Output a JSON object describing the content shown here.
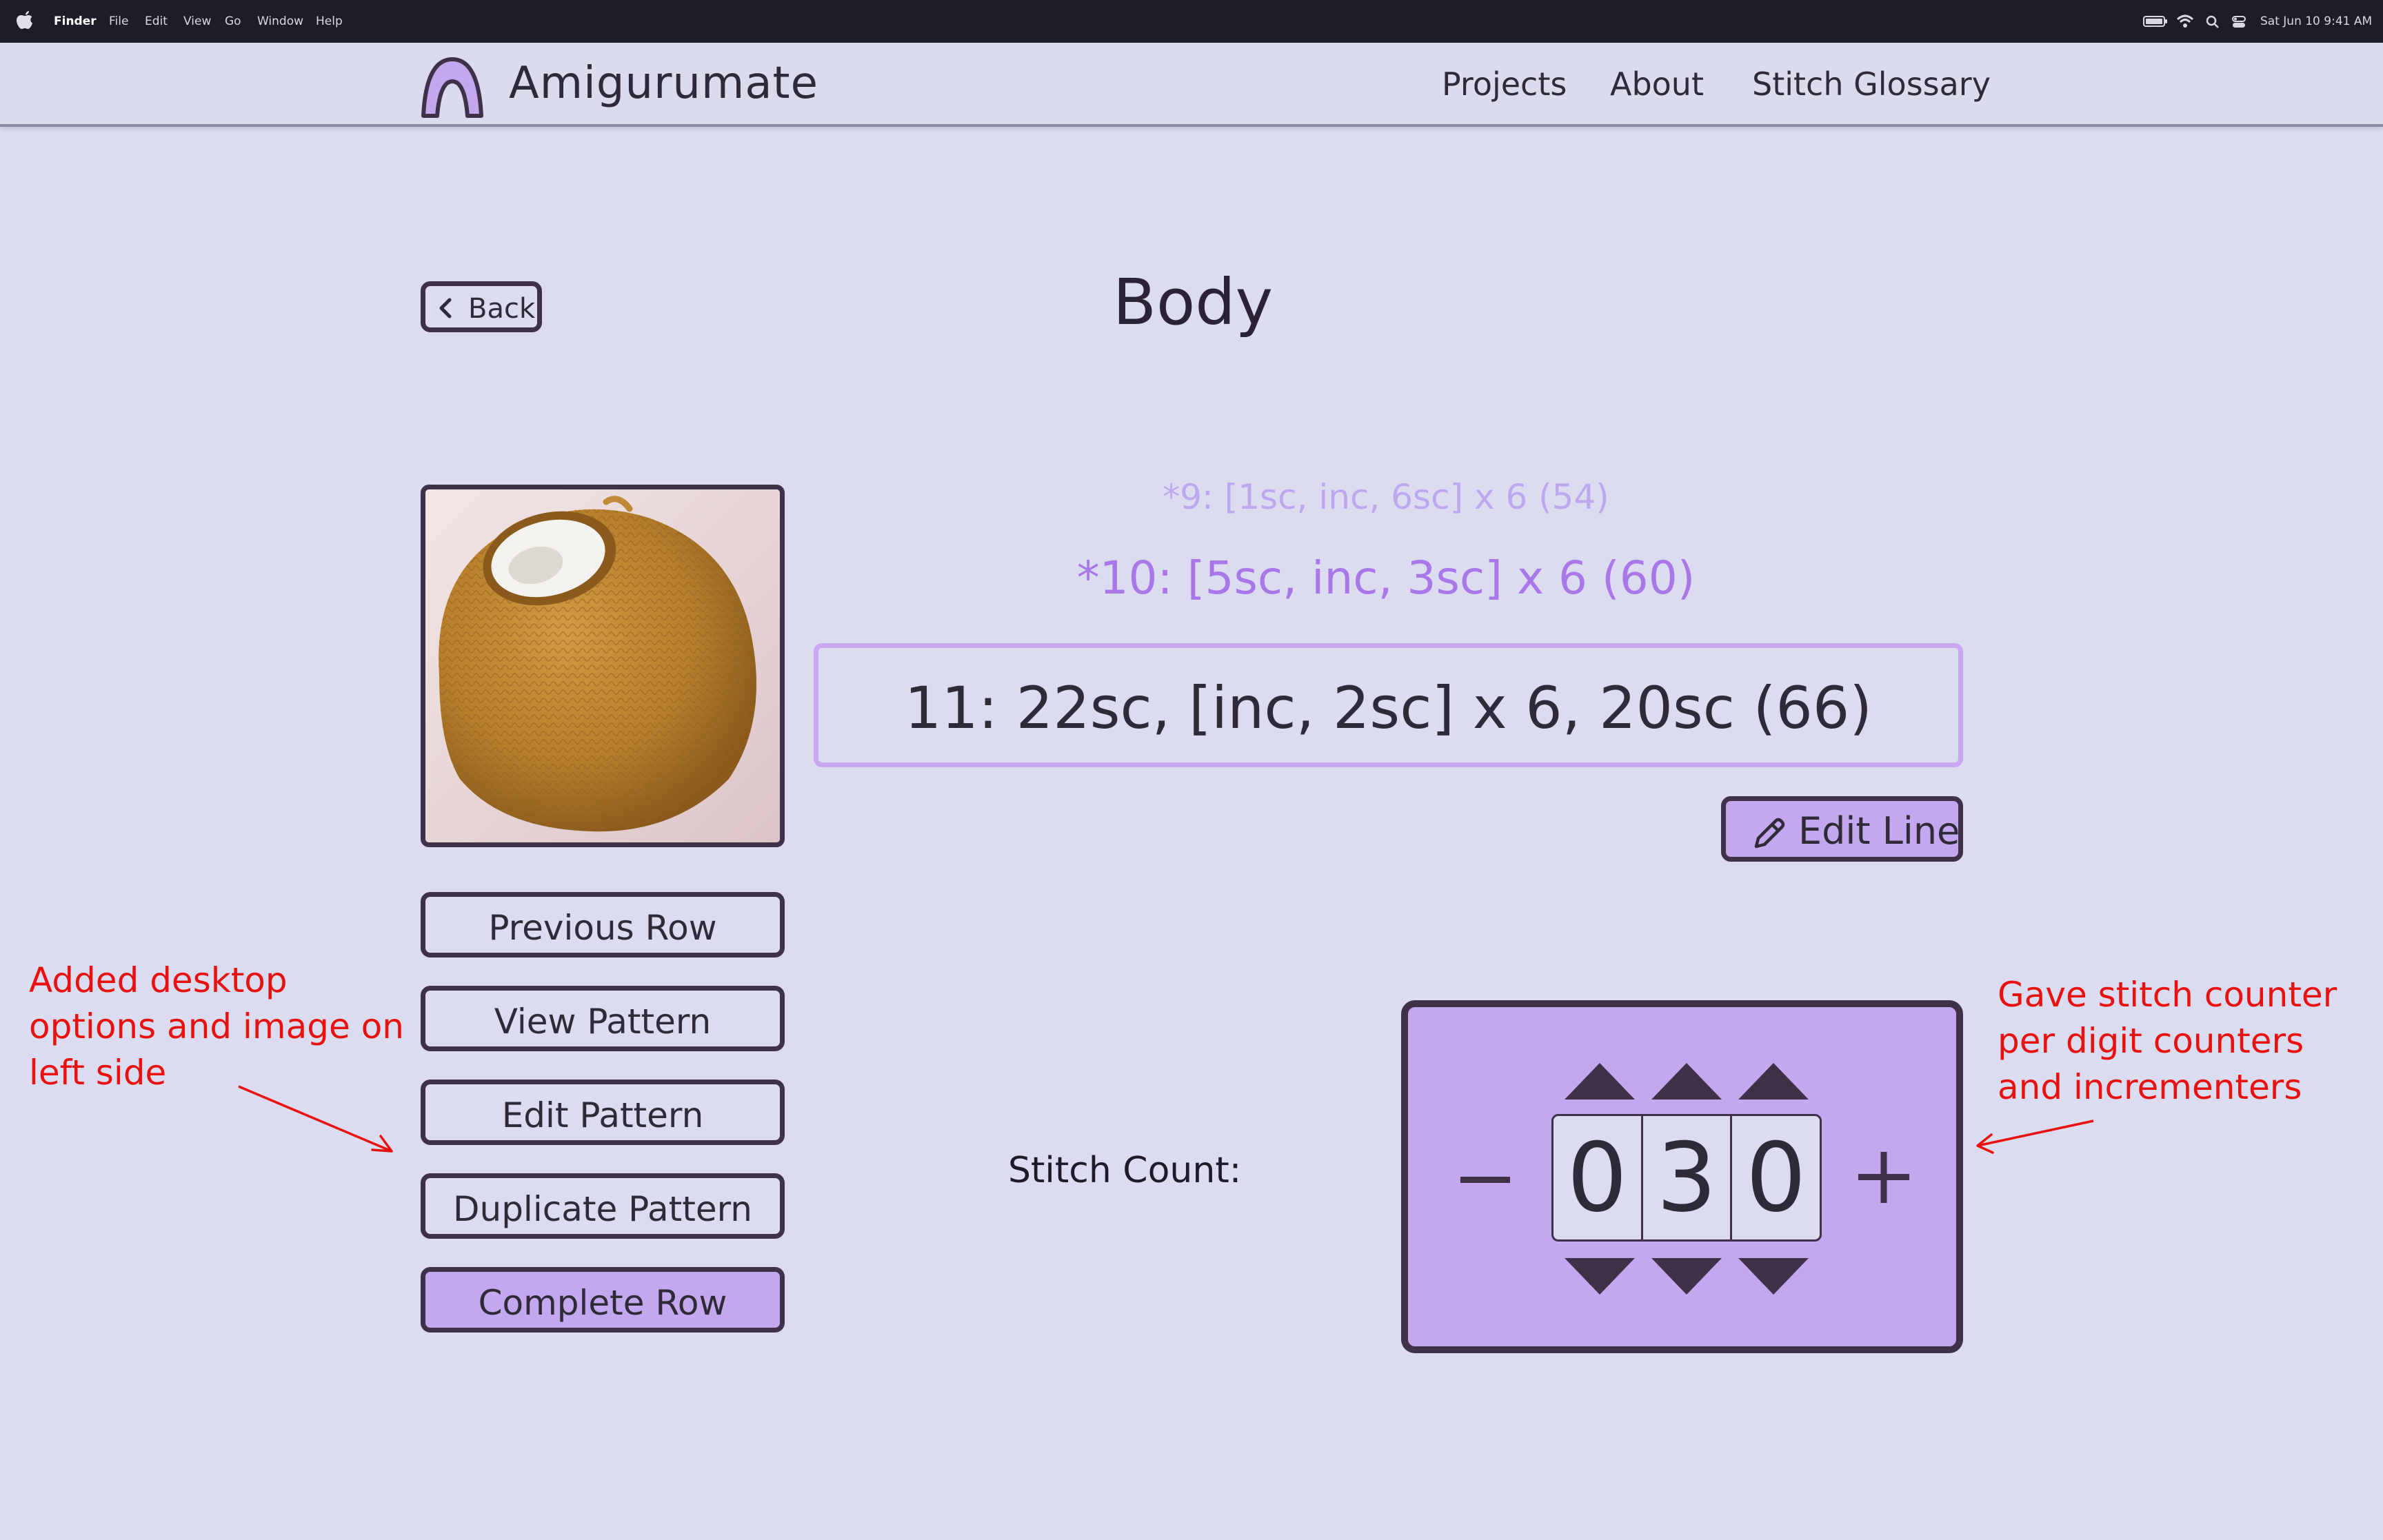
{
  "menubar": {
    "app_name": "Finder",
    "items": [
      "File",
      "Edit",
      "View",
      "Go",
      "Window",
      "Help"
    ],
    "datetime": "Sat Jun 10  9:41 AM"
  },
  "header": {
    "brand": "Amigurumate",
    "nav": [
      "Projects",
      "About",
      "Stitch Glossary"
    ]
  },
  "page": {
    "back_label": "Back",
    "title": "Body"
  },
  "pattern": {
    "previous_lines": [
      "*9: [1sc, inc, 6sc] x 6 (54)",
      "*10: [5sc, inc, 3sc] x 6 (60)"
    ],
    "current_line": "11: 22sc, [inc, 2sc] x 6, 20sc (66)",
    "edit_line_label": "Edit Line"
  },
  "sidebar": {
    "buttons": [
      "Previous Row",
      "View Pattern",
      "Edit Pattern",
      "Duplicate Pattern",
      "Complete Row"
    ]
  },
  "stitch_counter": {
    "label": "Stitch Count:",
    "digits": [
      "0",
      "3",
      "0"
    ]
  },
  "annotations": {
    "left": [
      "Added desktop",
      "options and image on",
      "left side"
    ],
    "right": [
      "Gave stitch counter",
      "per digit counters",
      "and incrementers"
    ]
  },
  "colors": {
    "background": "#dcdcf0",
    "accent_purple": "#c3a8f0",
    "border_dark": "#3e3148",
    "annotation_red": "#e8110f"
  }
}
